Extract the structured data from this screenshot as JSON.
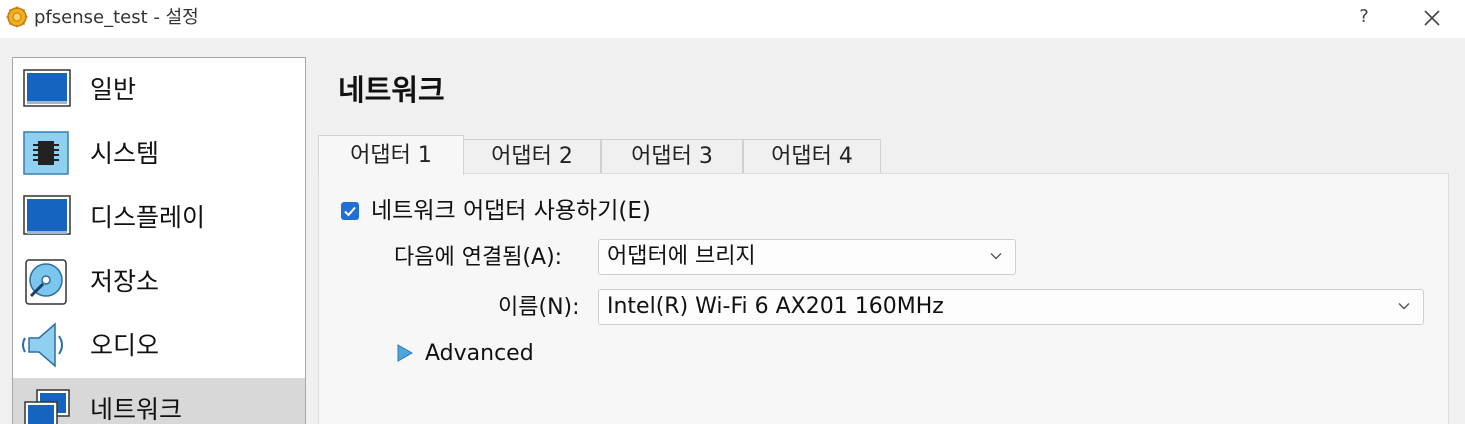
{
  "window": {
    "title": "pfsense_test - 설정",
    "help": "?",
    "icon": "virtualbox-app-icon"
  },
  "sidebar": {
    "items": [
      {
        "label": "일반",
        "icon": "general-monitor-icon"
      },
      {
        "label": "시스템",
        "icon": "system-chip-icon"
      },
      {
        "label": "디스플레이",
        "icon": "display-monitor-icon"
      },
      {
        "label": "저장소",
        "icon": "storage-disk-icon"
      },
      {
        "label": "오디오",
        "icon": "audio-speaker-icon"
      },
      {
        "label": "네트워크",
        "icon": "network-icon",
        "selected": true
      }
    ]
  },
  "page": {
    "title": "네트워크",
    "tabs": [
      {
        "label": "어댑터 1",
        "active": true
      },
      {
        "label": "어댑터 2"
      },
      {
        "label": "어댑터 3"
      },
      {
        "label": "어댑터 4"
      }
    ],
    "enable_adapter": {
      "label": "네트워크 어댑터 사용하기(E)",
      "checked": true
    },
    "attached_to": {
      "label": "다음에 연결됨(A):",
      "value": "어댑터에 브리지"
    },
    "name": {
      "label": "이름(N):",
      "value": "Intel(R) Wi-Fi 6 AX201 160MHz"
    },
    "advanced": {
      "label": "Advanced",
      "expanded": false
    }
  },
  "colors": {
    "accent": "#1f6fd6",
    "selection": "#d8d8d8",
    "icon_blue": "#1565c0"
  }
}
